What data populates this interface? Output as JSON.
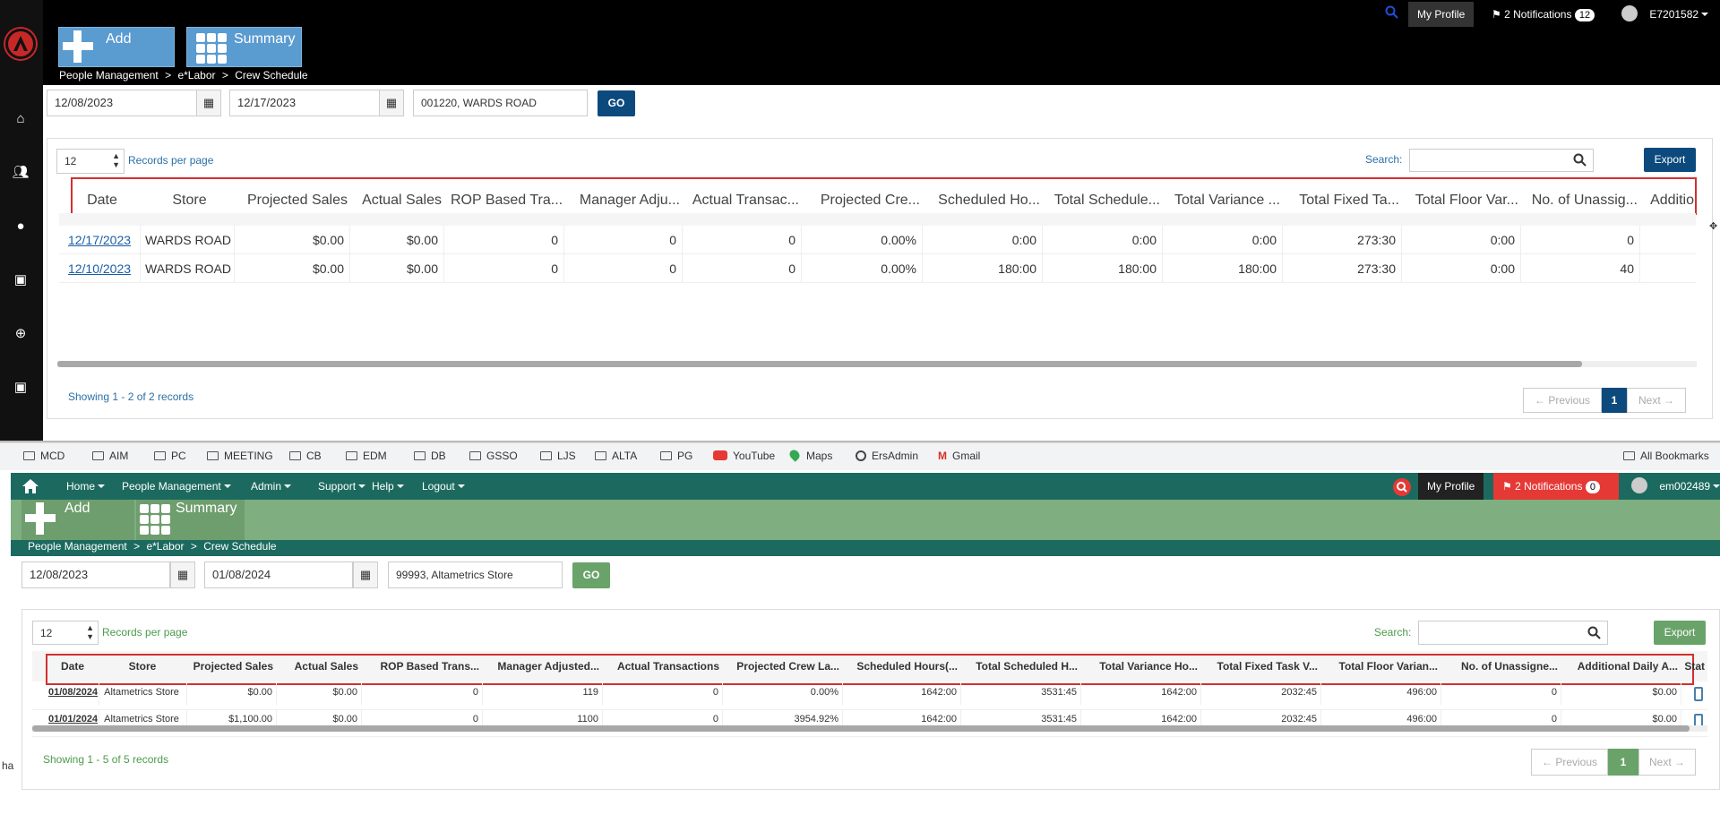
{
  "top_app": {
    "tiles": {
      "add": "Add",
      "summary": "Summary"
    },
    "header": {
      "my_profile": "My Profile",
      "notifications_label": "2 Notifications",
      "notifications_count": "12",
      "user": "E7201582"
    },
    "breadcrumb": [
      "People Management",
      "e*Labor",
      "Crew Schedule"
    ],
    "filters": {
      "start_date": "12/08/2023",
      "end_date": "12/17/2023",
      "store": "001220, WARDS ROAD",
      "go": "GO"
    },
    "records_per_page_value": "12",
    "records_per_page_label": "Records per page",
    "search_label": "Search:",
    "export": "Export",
    "columns": [
      "Date",
      "Store",
      "Projected Sales",
      "Actual Sales",
      "ROP Based Tra...",
      "Manager Adju...",
      "Actual Transac...",
      "Projected Cre...",
      "Scheduled Ho...",
      "Total Schedule...",
      "Total Variance ...",
      "Total Fixed Ta...",
      "Total Floor Var...",
      "No. of Unassig...",
      "Additio"
    ],
    "rows": [
      [
        "12/17/2023",
        "WARDS ROAD",
        "$0.00",
        "$0.00",
        "0",
        "0",
        "0",
        "0.00%",
        "0:00",
        "0:00",
        "0:00",
        "273:30",
        "0:00",
        "0"
      ],
      [
        "12/10/2023",
        "WARDS ROAD",
        "$0.00",
        "$0.00",
        "0",
        "0",
        "0",
        "0.00%",
        "180:00",
        "180:00",
        "180:00",
        "273:30",
        "0:00",
        "40"
      ]
    ],
    "showing": "Showing 1 - 2 of 2 records",
    "pagination": {
      "previous": "← Previous",
      "page": "1",
      "next": "Next →"
    },
    "accent": "#0c4a7e"
  },
  "bookmarks": {
    "items": [
      "MCD",
      "AIM",
      "PC",
      "MEETING",
      "CB",
      "EDM",
      "DB",
      "GSSO",
      "LJS",
      "ALTA",
      "PG",
      "YouTube",
      "Maps",
      "ErsAdmin",
      "Gmail"
    ],
    "all": "All Bookmarks"
  },
  "bottom_app": {
    "nav": [
      "Home",
      "People Management",
      "Admin",
      "Support",
      "Help",
      "Logout"
    ],
    "header": {
      "my_profile": "My Profile",
      "notifications_label": "2 Notifications",
      "notifications_count": "0",
      "user": "em002489"
    },
    "tiles": {
      "add": "Add",
      "summary": "Summary"
    },
    "breadcrumb": [
      "People Management",
      "e*Labor",
      "Crew Schedule"
    ],
    "filters": {
      "start_date": "12/08/2023",
      "end_date": "01/08/2024",
      "store": "99993, Altametrics Store",
      "go": "GO"
    },
    "records_per_page_value": "12",
    "records_per_page_label": "Records per page",
    "search_label": "Search:",
    "export": "Export",
    "columns": [
      "Date",
      "Store",
      "Projected Sales",
      "Actual Sales",
      "ROP Based Trans...",
      "Manager Adjusted...",
      "Actual Transactions",
      "Projected Crew La...",
      "Scheduled Hours(...",
      "Total Scheduled H...",
      "Total Variance Ho...",
      "Total Fixed Task V...",
      "Total Floor Varian...",
      "No. of Unassigne...",
      "Additional Daily A...",
      "Stat"
    ],
    "rows": [
      [
        "01/08/2024",
        "Altametrics Store",
        "$0.00",
        "$0.00",
        "0",
        "119",
        "0",
        "0.00%",
        "1642:00",
        "3531:45",
        "1642:00",
        "2032:45",
        "496:00",
        "0",
        "$0.00"
      ],
      [
        "01/01/2024",
        "Altametrics Store",
        "$1,100.00",
        "$0.00",
        "0",
        "1100",
        "0",
        "3954.92%",
        "1642:00",
        "3531:45",
        "1642:00",
        "2032:45",
        "496:00",
        "0",
        "$0.00"
      ]
    ],
    "showing": "Showing 1 - 5 of 5 records",
    "pagination": {
      "previous": "← Previous",
      "page": "1",
      "next": "Next →"
    },
    "accent": "#1c6a5f"
  },
  "stray_text": "ha"
}
